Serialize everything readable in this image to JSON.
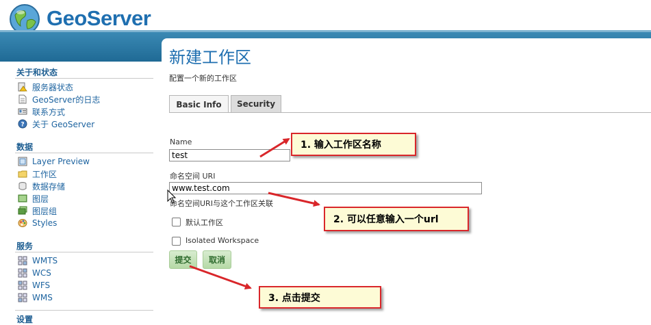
{
  "header": {
    "brand": "GeoServer"
  },
  "sidebar": {
    "sections": [
      {
        "title": "关于和状态",
        "items": [
          {
            "label": "服务器状态",
            "icon": "server-status-icon"
          },
          {
            "label": "GeoServer的日志",
            "icon": "log-document-icon"
          },
          {
            "label": "联系方式",
            "icon": "contact-card-icon"
          },
          {
            "label": "关于 GeoServer",
            "icon": "about-help-icon"
          }
        ]
      },
      {
        "title": "数据",
        "items": [
          {
            "label": "Layer Preview",
            "icon": "layer-preview-icon"
          },
          {
            "label": "工作区",
            "icon": "folder-icon"
          },
          {
            "label": "数据存储",
            "icon": "database-icon"
          },
          {
            "label": "图层",
            "icon": "layer-icon"
          },
          {
            "label": "图层组",
            "icon": "layer-group-icon"
          },
          {
            "label": "Styles",
            "icon": "palette-icon"
          }
        ]
      },
      {
        "title": "服务",
        "items": [
          {
            "label": "WMTS",
            "icon": "service-wmts-icon"
          },
          {
            "label": "WCS",
            "icon": "service-wcs-icon"
          },
          {
            "label": "WFS",
            "icon": "service-wfs-icon"
          },
          {
            "label": "WMS",
            "icon": "service-wms-icon"
          }
        ]
      },
      {
        "title": "设置",
        "items": []
      }
    ]
  },
  "main": {
    "title": "新建工作区",
    "description": "配置一个新的工作区",
    "tabs": [
      {
        "label": "Basic Info",
        "active": true
      },
      {
        "label": "Security",
        "active": false
      }
    ],
    "form": {
      "name_label": "Name",
      "name_value": "test",
      "uri_label": "命名空间 URI",
      "uri_value": "www.test.com",
      "uri_help": "命名空间URI与这个工作区关联",
      "default_label": "默认工作区",
      "default_checked": false,
      "isolated_label": "Isolated Workspace",
      "isolated_checked": false,
      "submit_label": "提交",
      "cancel_label": "取消"
    }
  },
  "annotations": {
    "step1": "1. 输入工作区名称",
    "step2": "2. 可以任意输入一个url",
    "step3": "3. 点击提交",
    "border_color": "#d9262a",
    "fill_color": "#fdfbd6"
  },
  "colors": {
    "accent": "#1f6fb0",
    "header_bar": "#2a78a4",
    "button_green": "#b6d9a6"
  }
}
